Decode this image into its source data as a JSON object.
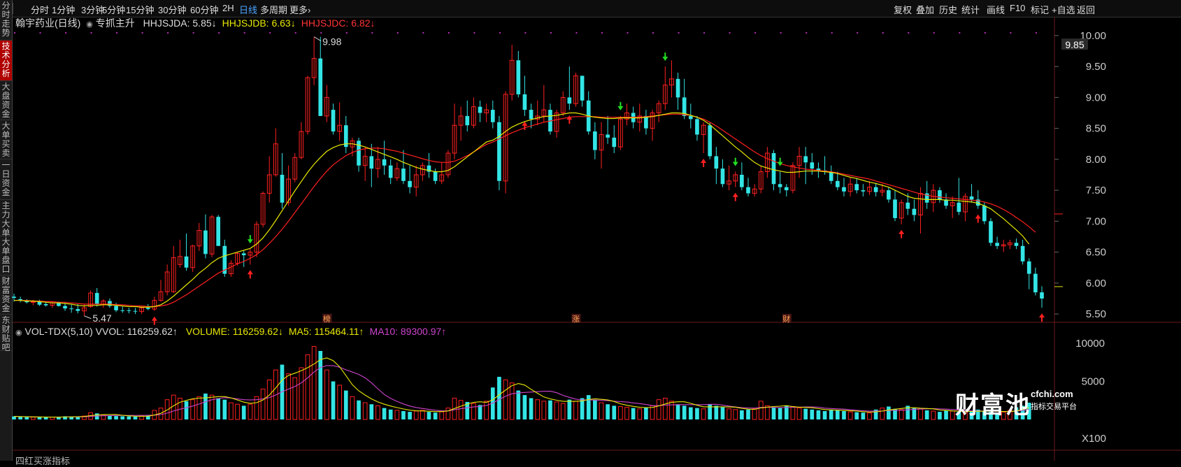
{
  "sidebar": {
    "tabs": [
      {
        "label": "分时走势",
        "active": false
      },
      {
        "label": "技术分析",
        "active": true
      },
      {
        "label": "大盘资金",
        "active": false
      },
      {
        "label": "大单买卖",
        "active": false
      },
      {
        "label": "一日资金",
        "active": false
      },
      {
        "label": "主力大单",
        "active": false
      },
      {
        "label": "大单盘口",
        "active": false
      },
      {
        "label": "财富资金",
        "active": false
      },
      {
        "label": "东财贴吧",
        "active": false
      }
    ]
  },
  "toolbar": {
    "periods": [
      "分时",
      "1分钟",
      "3分钟",
      "5分钟",
      "15分钟",
      "30分钟",
      "60分钟",
      "2H",
      "日线",
      "多周期",
      "更多›"
    ],
    "active_period": "日线",
    "tools": [
      "复权",
      "叠加",
      "历史",
      "统计",
      "画线",
      "F10",
      "标记",
      "+自选",
      "返回"
    ]
  },
  "price_panel": {
    "stock_title": "翰宇药业(日线)",
    "indicator_name": "专抓主升",
    "indicators": [
      {
        "label": "HHJSJDA: 5.85↓",
        "color": "#dddddd"
      },
      {
        "label": "HHJSJDB: 6.63↓",
        "color": "#e8e800"
      },
      {
        "label": "HHJSJDC: 6.82↓",
        "color": "#ff3333"
      }
    ],
    "high_label": "9.98",
    "low_label": "5.47",
    "current_price": "9.85",
    "event_marks": [
      {
        "label": "榜",
        "day": 49
      },
      {
        "label": "涨",
        "day": 88
      },
      {
        "label": "财",
        "day": 121
      }
    ]
  },
  "volume_panel": {
    "title": "VOL-TDX(5,10) VVOL: 116259.62↑",
    "series_labels": [
      {
        "label": "VOLUME: 116259.62↓",
        "color": "#e8e800"
      },
      {
        "label": "MA5: 115464.11↑",
        "color": "#e8e800"
      },
      {
        "label": "MA10: 89300.97↑",
        "color": "#cc44cc"
      }
    ],
    "unit_label": "X100"
  },
  "bottom_label": "四红买涨指标",
  "watermark": {
    "logo": "财富池",
    "domain": "cfchi.com",
    "tagline": "指标交易平台"
  },
  "colors": {
    "up": "#ff2020",
    "down": "#33e5e5",
    "ma_short": "#e8e800",
    "ma_long": "#ff2020",
    "ma10": "#cc44cc",
    "background": "#000000"
  },
  "chart_data": {
    "type": "candlestick",
    "title": "翰宇药业(日线)",
    "y_ticks": [
      "10.00",
      "9.50",
      "9.00",
      "8.50",
      "8.00",
      "7.50",
      "7.00",
      "6.50",
      "6.00",
      "5.50"
    ],
    "ylim": [
      5.4,
      10.1
    ],
    "volume_ticks": [
      "10000",
      "5000"
    ],
    "volume_ylim": [
      0,
      11200
    ],
    "ohlc": [
      [
        5.78,
        5.83,
        5.7,
        5.76
      ],
      [
        5.74,
        5.78,
        5.69,
        5.72
      ],
      [
        5.72,
        5.74,
        5.67,
        5.69
      ],
      [
        5.69,
        5.73,
        5.64,
        5.7
      ],
      [
        5.7,
        5.73,
        5.63,
        5.65
      ],
      [
        5.66,
        5.7,
        5.62,
        5.64
      ],
      [
        5.64,
        5.7,
        5.6,
        5.68
      ],
      [
        5.68,
        5.7,
        5.62,
        5.63
      ],
      [
        5.63,
        5.68,
        5.55,
        5.59
      ],
      [
        5.59,
        5.65,
        5.52,
        5.58
      ],
      [
        5.58,
        5.66,
        5.51,
        5.55
      ],
      [
        5.55,
        5.66,
        5.47,
        5.6
      ],
      [
        5.62,
        5.88,
        5.6,
        5.84
      ],
      [
        5.84,
        5.92,
        5.62,
        5.66
      ],
      [
        5.66,
        5.74,
        5.6,
        5.71
      ],
      [
        5.71,
        5.75,
        5.6,
        5.63
      ],
      [
        5.63,
        5.68,
        5.53,
        5.56
      ],
      [
        5.56,
        5.62,
        5.52,
        5.55
      ],
      [
        5.56,
        5.6,
        5.51,
        5.55
      ],
      [
        5.55,
        5.6,
        5.5,
        5.54
      ],
      [
        5.54,
        5.62,
        5.5,
        5.6
      ],
      [
        5.6,
        5.66,
        5.56,
        5.58
      ],
      [
        5.58,
        5.78,
        5.55,
        5.72
      ],
      [
        5.72,
        6.05,
        5.7,
        5.86
      ],
      [
        5.86,
        6.3,
        5.8,
        6.18
      ],
      [
        5.86,
        6.6,
        5.84,
        6.41
      ],
      [
        6.3,
        6.7,
        6.25,
        6.43
      ],
      [
        6.43,
        6.8,
        6.2,
        6.25
      ],
      [
        6.25,
        6.62,
        6.18,
        6.6
      ],
      [
        6.6,
        6.97,
        6.52,
        6.85
      ],
      [
        6.85,
        7.11,
        6.4,
        6.47
      ],
      [
        6.47,
        7.1,
        6.42,
        7.07
      ],
      [
        7.07,
        7.1,
        6.6,
        6.6
      ],
      [
        6.6,
        6.7,
        6.1,
        6.15
      ],
      [
        6.15,
        6.37,
        6.1,
        6.32
      ],
      [
        6.32,
        6.5,
        6.28,
        6.48
      ],
      [
        6.48,
        6.52,
        6.26,
        6.45
      ],
      [
        6.45,
        6.55,
        6.3,
        6.5
      ],
      [
        6.5,
        7.0,
        6.42,
        6.95
      ],
      [
        6.95,
        7.48,
        6.9,
        7.45
      ],
      [
        7.45,
        8.05,
        7.3,
        7.75
      ],
      [
        7.75,
        8.5,
        7.72,
        8.25
      ],
      [
        7.75,
        8.1,
        7.2,
        7.3
      ],
      [
        7.3,
        7.9,
        7.25,
        7.68
      ],
      [
        7.68,
        8.1,
        7.63,
        8.03
      ],
      [
        8.03,
        8.6,
        8.0,
        8.45
      ],
      [
        8.45,
        9.35,
        8.4,
        9.32
      ],
      [
        9.32,
        9.98,
        9.2,
        9.63
      ],
      [
        9.63,
        9.98,
        8.7,
        8.7
      ],
      [
        8.7,
        9.2,
        8.6,
        9.0
      ],
      [
        8.8,
        8.9,
        8.4,
        8.45
      ],
      [
        8.45,
        8.92,
        8.3,
        8.55
      ],
      [
        8.55,
        8.7,
        8.1,
        8.2
      ],
      [
        8.2,
        8.35,
        8.05,
        8.3
      ],
      [
        8.3,
        8.35,
        7.8,
        7.9
      ],
      [
        7.9,
        8.2,
        7.65,
        8.05
      ],
      [
        8.05,
        8.25,
        7.55,
        7.85
      ],
      [
        7.85,
        8.2,
        7.7,
        8.0
      ],
      [
        8.0,
        8.3,
        7.75,
        7.9
      ],
      [
        7.9,
        8.0,
        7.6,
        7.7
      ],
      [
        7.7,
        7.95,
        7.65,
        7.85
      ],
      [
        7.85,
        8.15,
        7.6,
        7.65
      ],
      [
        7.65,
        7.9,
        7.45,
        7.55
      ],
      [
        7.55,
        7.9,
        7.4,
        7.75
      ],
      [
        7.75,
        7.95,
        7.65,
        7.9
      ],
      [
        7.9,
        8.1,
        7.7,
        7.8
      ],
      [
        7.8,
        7.85,
        7.6,
        7.65
      ],
      [
        7.65,
        7.95,
        7.6,
        7.75
      ],
      [
        7.75,
        8.15,
        7.7,
        8.1
      ],
      [
        8.1,
        8.9,
        8.0,
        8.55
      ],
      [
        8.55,
        8.85,
        8.3,
        8.7
      ],
      [
        8.7,
        8.95,
        8.45,
        8.55
      ],
      [
        8.55,
        9.0,
        8.5,
        8.85
      ],
      [
        8.85,
        8.95,
        8.6,
        8.75
      ],
      [
        8.75,
        8.9,
        8.6,
        8.8
      ],
      [
        8.8,
        8.95,
        8.5,
        8.6
      ],
      [
        8.6,
        8.7,
        7.5,
        7.65
      ],
      [
        7.65,
        9.1,
        7.45,
        9.05
      ],
      [
        9.05,
        9.85,
        8.95,
        9.6
      ],
      [
        9.6,
        9.75,
        9.0,
        9.05
      ],
      [
        9.05,
        9.35,
        8.7,
        8.8
      ],
      [
        8.8,
        8.9,
        8.5,
        8.65
      ],
      [
        8.65,
        8.95,
        8.55,
        8.7
      ],
      [
        8.7,
        9.2,
        8.6,
        8.8
      ],
      [
        8.8,
        8.9,
        8.4,
        8.45
      ],
      [
        8.45,
        8.8,
        8.35,
        8.75
      ],
      [
        8.75,
        9.1,
        8.7,
        9.0
      ],
      [
        9.0,
        9.5,
        8.8,
        8.9
      ],
      [
        8.9,
        9.4,
        8.85,
        9.35
      ],
      [
        9.35,
        9.3,
        8.85,
        8.95
      ],
      [
        8.95,
        9.1,
        8.4,
        8.45
      ],
      [
        8.45,
        8.6,
        8.0,
        8.15
      ],
      [
        8.15,
        8.6,
        7.85,
        8.4
      ],
      [
        8.4,
        8.7,
        8.25,
        8.35
      ],
      [
        8.35,
        8.55,
        8.1,
        8.2
      ],
      [
        8.2,
        8.7,
        8.15,
        8.65
      ],
      [
        8.65,
        8.9,
        8.55,
        8.75
      ],
      [
        8.75,
        8.85,
        8.5,
        8.6
      ],
      [
        8.6,
        8.9,
        8.45,
        8.7
      ],
      [
        8.7,
        8.8,
        8.4,
        8.5
      ],
      [
        8.5,
        8.8,
        8.3,
        8.75
      ],
      [
        8.75,
        8.95,
        8.6,
        8.9
      ],
      [
        8.9,
        9.5,
        8.8,
        9.2
      ],
      [
        9.2,
        9.6,
        9.0,
        9.3
      ],
      [
        9.3,
        9.4,
        8.8,
        9.0
      ],
      [
        9.0,
        9.3,
        8.65,
        8.7
      ],
      [
        8.7,
        8.9,
        8.5,
        8.65
      ],
      [
        8.65,
        8.7,
        8.3,
        8.4
      ],
      [
        8.4,
        8.6,
        8.1,
        8.55
      ],
      [
        8.55,
        8.6,
        8.0,
        8.05
      ],
      [
        8.05,
        8.2,
        7.6,
        7.85
      ],
      [
        7.85,
        8.0,
        7.55,
        7.6
      ],
      [
        7.6,
        7.9,
        7.5,
        7.65
      ],
      [
        7.65,
        7.8,
        7.55,
        7.75
      ],
      [
        7.75,
        7.95,
        7.5,
        7.55
      ],
      [
        7.55,
        7.7,
        7.4,
        7.45
      ],
      [
        7.45,
        7.6,
        7.4,
        7.52
      ],
      [
        7.52,
        7.9,
        7.45,
        7.8
      ],
      [
        7.8,
        8.2,
        7.7,
        8.1
      ],
      [
        8.1,
        8.15,
        7.5,
        7.6
      ],
      [
        7.6,
        7.8,
        7.45,
        7.55
      ],
      [
        7.55,
        7.6,
        7.4,
        7.5
      ],
      [
        7.5,
        7.95,
        7.45,
        7.9
      ],
      [
        7.9,
        8.2,
        7.7,
        8.05
      ],
      [
        8.05,
        8.2,
        7.6,
        7.95
      ],
      [
        7.95,
        8.1,
        7.75,
        7.85
      ],
      [
        7.85,
        7.95,
        7.7,
        7.82
      ],
      [
        7.82,
        8.05,
        7.75,
        7.8
      ],
      [
        7.8,
        7.9,
        7.6,
        7.65
      ],
      [
        7.65,
        7.8,
        7.5,
        7.55
      ],
      [
        7.55,
        7.7,
        7.4,
        7.48
      ],
      [
        7.48,
        7.7,
        7.4,
        7.6
      ],
      [
        7.6,
        7.7,
        7.45,
        7.5
      ],
      [
        7.5,
        7.6,
        7.4,
        7.48
      ],
      [
        7.48,
        7.65,
        7.42,
        7.55
      ],
      [
        7.55,
        7.62,
        7.4,
        7.47
      ],
      [
        7.47,
        7.6,
        7.4,
        7.5
      ],
      [
        7.5,
        7.55,
        7.3,
        7.35
      ],
      [
        7.35,
        7.5,
        7.0,
        7.05
      ],
      [
        7.05,
        7.35,
        6.95,
        7.3
      ],
      [
        7.3,
        7.45,
        7.1,
        7.2
      ],
      [
        7.2,
        7.35,
        7.0,
        7.1
      ],
      [
        7.1,
        7.55,
        6.8,
        7.45
      ],
      [
        7.45,
        7.65,
        7.2,
        7.3
      ],
      [
        7.3,
        7.6,
        7.15,
        7.5
      ],
      [
        7.5,
        7.55,
        7.3,
        7.35
      ],
      [
        7.35,
        7.45,
        7.2,
        7.25
      ],
      [
        7.25,
        7.4,
        7.05,
        7.3
      ],
      [
        7.3,
        7.7,
        7.1,
        7.15
      ],
      [
        7.15,
        7.45,
        7.0,
        7.4
      ],
      [
        7.4,
        7.6,
        7.3,
        7.35
      ],
      [
        7.35,
        7.5,
        7.2,
        7.25
      ],
      [
        7.25,
        7.3,
        6.95,
        7.0
      ],
      [
        7.0,
        7.05,
        6.6,
        6.65
      ],
      [
        6.65,
        6.75,
        6.55,
        6.6
      ],
      [
        6.6,
        6.7,
        6.5,
        6.62
      ],
      [
        6.62,
        6.7,
        6.55,
        6.65
      ],
      [
        6.65,
        6.72,
        6.55,
        6.6
      ],
      [
        6.6,
        6.7,
        6.3,
        6.35
      ],
      [
        6.35,
        6.4,
        5.9,
        6.15
      ],
      [
        6.15,
        6.25,
        5.8,
        5.85
      ],
      [
        5.85,
        5.95,
        5.6,
        5.75
      ]
    ],
    "ma_short": [
      5.72,
      5.72,
      5.71,
      5.71,
      5.7,
      5.69,
      5.68,
      5.68,
      5.67,
      5.66,
      5.64,
      5.63,
      5.64,
      5.64,
      5.65,
      5.65,
      5.64,
      5.63,
      5.62,
      5.62,
      5.61,
      5.61,
      5.62,
      5.65,
      5.71,
      5.79,
      5.88,
      5.97,
      6.06,
      6.16,
      6.24,
      6.33,
      6.4,
      6.44,
      6.47,
      6.5,
      6.53,
      6.56,
      6.63,
      6.73,
      6.86,
      7.01,
      7.17,
      7.33,
      7.49,
      7.64,
      7.79,
      7.92,
      8.03,
      8.13,
      8.19,
      8.23,
      8.25,
      8.25,
      8.23,
      8.2,
      8.16,
      8.12,
      8.08,
      8.04,
      8.0,
      7.95,
      7.91,
      7.87,
      7.84,
      7.82,
      7.8,
      7.8,
      7.82,
      7.88,
      7.96,
      8.04,
      8.12,
      8.2,
      8.28,
      8.31,
      8.37,
      8.45,
      8.52,
      8.57,
      8.61,
      8.64,
      8.67,
      8.69,
      8.7,
      8.71,
      8.73,
      8.75,
      8.75,
      8.73,
      8.7,
      8.68,
      8.67,
      8.66,
      8.66,
      8.67,
      8.67,
      8.67,
      8.67,
      8.68,
      8.69,
      8.71,
      8.73,
      8.75,
      8.75,
      8.74,
      8.71,
      8.68,
      8.63,
      8.56,
      8.47,
      8.38,
      8.29,
      8.2,
      8.12,
      8.03,
      7.95,
      7.89,
      7.86,
      7.83,
      7.81,
      7.79,
      7.79,
      7.8,
      7.81,
      7.81,
      7.81,
      7.8,
      7.79,
      7.77,
      7.74,
      7.71,
      7.69,
      7.66,
      7.63,
      7.61,
      7.58,
      7.55,
      7.5,
      7.45,
      7.4,
      7.37,
      7.36,
      7.35,
      7.35,
      7.35,
      7.34,
      7.34,
      7.33,
      7.32,
      7.31,
      7.29,
      7.25,
      7.2,
      7.12,
      7.04,
      6.95,
      6.86,
      6.76,
      6.63
    ],
    "ma_long": [
      5.72,
      5.72,
      5.72,
      5.71,
      5.71,
      5.7,
      5.7,
      5.69,
      5.69,
      5.68,
      5.67,
      5.66,
      5.66,
      5.66,
      5.66,
      5.66,
      5.65,
      5.65,
      5.64,
      5.63,
      5.63,
      5.62,
      5.62,
      5.63,
      5.65,
      5.69,
      5.75,
      5.81,
      5.88,
      5.95,
      6.02,
      6.09,
      6.16,
      6.21,
      6.26,
      6.31,
      6.35,
      6.4,
      6.46,
      6.54,
      6.64,
      6.75,
      6.87,
      7.0,
      7.14,
      7.28,
      7.42,
      7.56,
      7.69,
      7.81,
      7.91,
      7.99,
      8.06,
      8.11,
      8.15,
      8.17,
      8.18,
      8.18,
      8.17,
      8.15,
      8.13,
      8.1,
      8.07,
      8.04,
      8.01,
      7.98,
      7.96,
      7.95,
      7.95,
      7.97,
      8.01,
      8.06,
      8.12,
      8.18,
      8.24,
      8.28,
      8.33,
      8.38,
      8.43,
      8.47,
      8.51,
      8.54,
      8.57,
      8.6,
      8.62,
      8.64,
      8.66,
      8.68,
      8.69,
      8.69,
      8.69,
      8.69,
      8.68,
      8.68,
      8.68,
      8.68,
      8.68,
      8.68,
      8.68,
      8.69,
      8.7,
      8.71,
      8.72,
      8.73,
      8.73,
      8.72,
      8.71,
      8.68,
      8.65,
      8.6,
      8.54,
      8.47,
      8.4,
      8.33,
      8.26,
      8.19,
      8.12,
      8.06,
      8.01,
      7.97,
      7.93,
      7.9,
      7.88,
      7.86,
      7.84,
      7.83,
      7.82,
      7.81,
      7.8,
      7.78,
      7.76,
      7.74,
      7.72,
      7.7,
      7.68,
      7.65,
      7.62,
      7.59,
      7.56,
      7.53,
      7.5,
      7.47,
      7.44,
      7.42,
      7.4,
      7.39,
      7.38,
      7.37,
      7.36,
      7.35,
      7.34,
      7.33,
      7.31,
      7.28,
      7.24,
      7.19,
      7.13,
      7.06,
      6.99,
      6.91,
      6.82
    ],
    "volume": [
      400,
      350,
      320,
      300,
      280,
      300,
      320,
      300,
      420,
      380,
      400,
      450,
      900,
      800,
      600,
      500,
      450,
      420,
      400,
      380,
      450,
      500,
      1200,
      1500,
      2600,
      3200,
      2800,
      2400,
      2600,
      3000,
      3400,
      3200,
      2800,
      2600,
      2200,
      2000,
      1800,
      2000,
      3000,
      4000,
      5200,
      6500,
      7200,
      6000,
      5500,
      6800,
      8500,
      9600,
      9000,
      6500,
      5000,
      4500,
      3800,
      3000,
      2500,
      2200,
      2000,
      1800,
      1500,
      1300,
      1200,
      1100,
      1000,
      1100,
      1200,
      1000,
      900,
      1000,
      1500,
      2800,
      2500,
      2300,
      2100,
      1900,
      2400,
      4200,
      5600,
      5200,
      4800,
      3800,
      3200,
      2800,
      2600,
      2400,
      2500,
      2300,
      2100,
      2600,
      2400,
      2800,
      3200,
      2600,
      2200,
      2000,
      1800,
      1700,
      1600,
      1500,
      1400,
      1600,
      1800,
      2600,
      2800,
      2400,
      2000,
      1800,
      1600,
      1500,
      1400,
      2000,
      1800,
      1600,
      1400,
      1300,
      1200,
      1300,
      1400,
      2400,
      1800,
      1600,
      1500,
      1800,
      1700,
      1500,
      1400,
      1300,
      1200,
      1100,
      1300,
      1200,
      1100,
      1000,
      950,
      900,
      850,
      1300,
      1500,
      1700,
      1400,
      1300,
      1800,
      1500,
      1400,
      1200,
      1100,
      1000,
      1200,
      1100,
      1000,
      900,
      1100,
      1300,
      1100,
      1000,
      900,
      950,
      1200,
      1600,
      1800,
      2200
    ]
  }
}
